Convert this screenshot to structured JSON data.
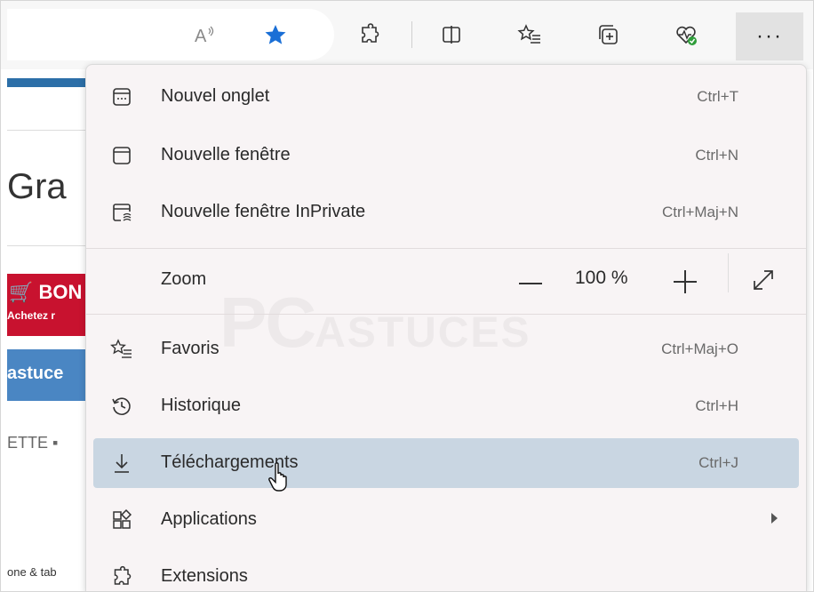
{
  "toolbar": {
    "icons": [
      "read-aloud-icon",
      "favorite-star-icon",
      "extensions-icon",
      "split-screen-icon",
      "favorites-icon",
      "collections-icon",
      "browser-essentials-icon"
    ],
    "more_label": "···"
  },
  "page": {
    "heading_fragment": "Gra",
    "promo_fragment": "🛒 BON",
    "promo_sub_fragment": "Achetez r",
    "nav_fragment": "astuce",
    "menu_fragment": "ETTE ▪",
    "footer_fragment": "one & tab"
  },
  "menu": {
    "items": [
      {
        "label": "Nouvel onglet",
        "shortcut": "Ctrl+T",
        "icon": "new-tab-icon"
      },
      {
        "label": "Nouvelle fenêtre",
        "shortcut": "Ctrl+N",
        "icon": "new-window-icon"
      },
      {
        "label": "Nouvelle fenêtre InPrivate",
        "shortcut": "Ctrl+Maj+N",
        "icon": "inprivate-window-icon"
      },
      {
        "label": "Favoris",
        "shortcut": "Ctrl+Maj+O",
        "icon": "favorites-icon"
      },
      {
        "label": "Historique",
        "shortcut": "Ctrl+H",
        "icon": "history-icon"
      },
      {
        "label": "Téléchargements",
        "shortcut": "Ctrl+J",
        "icon": "download-icon"
      },
      {
        "label": "Applications",
        "shortcut": "",
        "icon": "applications-icon"
      },
      {
        "label": "Extensions",
        "shortcut": "",
        "icon": "extensions-icon"
      }
    ],
    "zoom": {
      "label": "Zoom",
      "value": "100 %",
      "minus_icon": "minus-icon",
      "plus_icon": "plus-icon",
      "fullscreen_icon": "fullscreen-icon"
    },
    "highlighted_item": "Téléchargements"
  },
  "watermark": {
    "text": "PC",
    "sub": "ASTUCES"
  },
  "colors": {
    "menu_bg": "#f8f4f5",
    "highlight": "#c9d6e2",
    "star": "#1a6fd6",
    "promo_red": "#c8122f",
    "nav_blue": "#4a86c3"
  }
}
